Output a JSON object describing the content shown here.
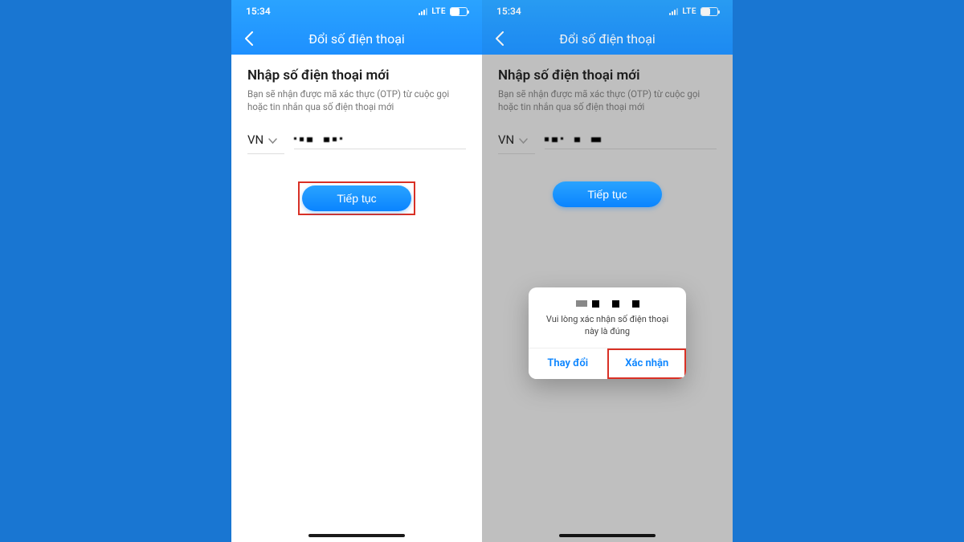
{
  "statusbar": {
    "time": "15:34",
    "network": "LTE"
  },
  "nav": {
    "title": "Đổi số điện thoại"
  },
  "form": {
    "heading": "Nhập số điện thoại mới",
    "subtext": "Bạn sẽ nhận được mã xác thực (OTP) từ cuộc gọi hoặc tin nhắn qua số điện thoại mới",
    "country_code": "VN",
    "continue_label": "Tiếp tục"
  },
  "dialog": {
    "message": "Vui lòng xác nhận số điện thoại này là đúng",
    "change_label": "Thay đổi",
    "confirm_label": "Xác nhận"
  }
}
